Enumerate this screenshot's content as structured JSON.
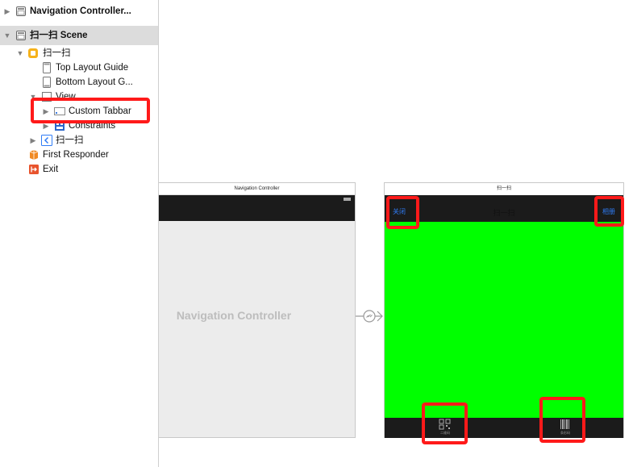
{
  "outline": {
    "items": [
      {
        "label": "Navigation Controller...",
        "icon": "navigation-controller-icon"
      },
      {
        "label": "扫一扫 Scene",
        "icon": "scene-icon"
      },
      {
        "label": "扫一扫",
        "icon": "view-controller-icon"
      },
      {
        "label": "Top Layout Guide",
        "icon": "layout-guide-icon"
      },
      {
        "label": "Bottom Layout G...",
        "icon": "layout-guide-icon"
      },
      {
        "label": "View",
        "icon": "view-icon"
      },
      {
        "label": "Custom Tabbar",
        "icon": "tabbar-icon"
      },
      {
        "label": "Constraints",
        "icon": "constraints-icon"
      },
      {
        "label": "扫一扫",
        "icon": "back-chevron-icon"
      },
      {
        "label": "First Responder",
        "icon": "first-responder-icon"
      },
      {
        "label": "Exit",
        "icon": "exit-icon"
      }
    ]
  },
  "canvas": {
    "nav_controller": {
      "title": "Navigation Controller",
      "placeholder": "Navigation Controller"
    },
    "scan_scene": {
      "title": "扫一扫",
      "nav_title": "扫一扫",
      "left_button": "关闭",
      "right_button": "相册",
      "tab_qr_label": "二维码",
      "tab_barcode_label": "条形码"
    }
  },
  "colors": {
    "highlight": "#ff1a1a",
    "scene_background": "#00ff00",
    "bar_background": "#1b1b1b",
    "button_tint": "#2f7cf6"
  }
}
